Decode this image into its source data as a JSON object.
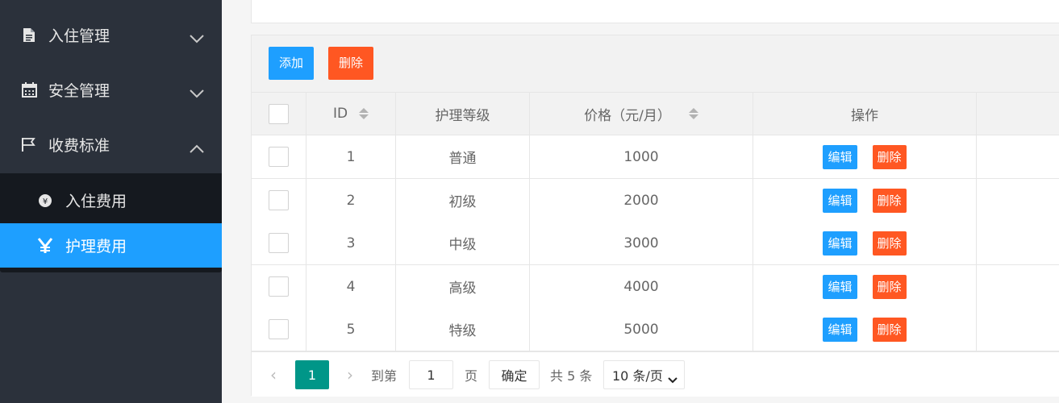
{
  "sidebar": {
    "items": [
      {
        "label": "入住管理",
        "icon": "file-icon",
        "expanded": false
      },
      {
        "label": "安全管理",
        "icon": "calendar-icon",
        "expanded": false
      },
      {
        "label": "收费标准",
        "icon": "flag-icon",
        "expanded": true
      }
    ],
    "submenu": [
      {
        "label": "入住费用",
        "icon": "cny-circle-icon",
        "active": false
      },
      {
        "label": "护理费用",
        "icon": "yen-icon",
        "active": true
      }
    ]
  },
  "toolbar": {
    "add_label": "添加",
    "delete_label": "删除"
  },
  "table": {
    "headers": {
      "id": "ID",
      "level": "护理等级",
      "price": "价格（元/月）",
      "actions": "操作"
    },
    "rows": [
      {
        "id": "1",
        "level": "普通",
        "price": "1000"
      },
      {
        "id": "2",
        "level": "初级",
        "price": "2000"
      },
      {
        "id": "3",
        "level": "中级",
        "price": "3000"
      },
      {
        "id": "4",
        "level": "高级",
        "price": "4000"
      },
      {
        "id": "5",
        "level": "特级",
        "price": "5000"
      }
    ],
    "row_actions": {
      "edit": "编辑",
      "delete": "删除"
    }
  },
  "pager": {
    "prev": "‹",
    "current": "1",
    "next": "›",
    "goto_label": "到第",
    "goto_value": "1",
    "page_unit": "页",
    "confirm": "确定",
    "total": "共 5 条",
    "page_size": "10 条/页"
  },
  "colors": {
    "primary": "#1e9fff",
    "danger": "#ff5722",
    "pager_active": "#009688",
    "sidebar_bg": "#2b313b"
  }
}
